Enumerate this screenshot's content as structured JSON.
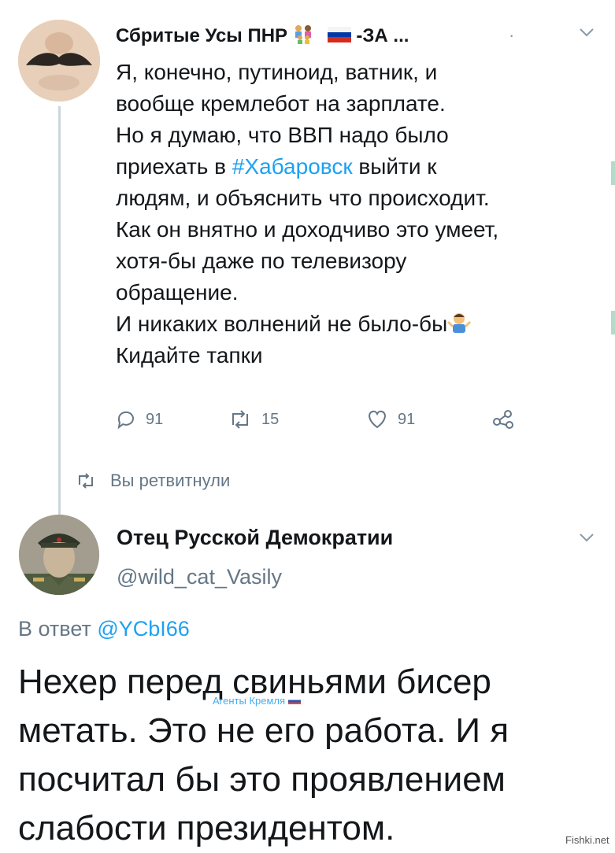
{
  "tweet1": {
    "display_name": "Сбритые Усы ПНР",
    "name_suffix": " -ЗА ...",
    "separator": "·",
    "lines": [
      "Я, конечно, путиноид, ватник, и",
      "вообще кремлебот на зарплате.",
      "Но я думаю, что ВВП надо было",
      "приехать в ",
      "#Хабаровск",
      " выйти к",
      "людям, и объяснить что происходит.",
      "Как он внятно и доходчиво это умеет,",
      "хотя-бы даже по телевизору",
      "обращение.",
      "И никаких волнений не было-бы",
      "Кидайте тапки"
    ],
    "reply_count": "91",
    "retweet_count": "15",
    "like_count": "91"
  },
  "retweet_note": "Вы ретвитнули",
  "tweet2": {
    "display_name": "Отец Русской Демократии",
    "handle": "@wild_cat_Vasily",
    "reply_prefix": "В ответ ",
    "reply_mention": "@YCbI66",
    "text": "Нехер перед свиньями бисер метать. Это не его работа. И я посчитал бы это проявлением слабости президентом."
  },
  "watermark": "Агенты Кремля",
  "site_mark": "Fishki.net",
  "colors": {
    "link": "#1da1f2",
    "secondary": "#657786",
    "text": "#14171a",
    "thread_line": "#ccd6dd"
  }
}
